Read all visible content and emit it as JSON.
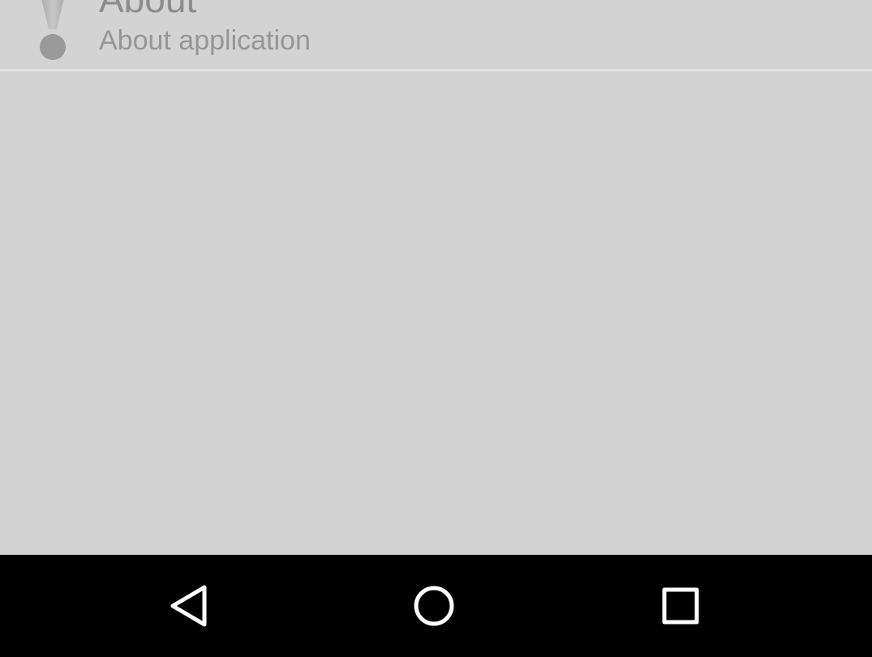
{
  "settings_item": {
    "title": "About",
    "summary": "About application",
    "icon": "info-exclamation-icon"
  },
  "nav_bar": {
    "back_icon": "back-triangle-icon",
    "home_icon": "home-circle-icon",
    "recents_icon": "recents-square-icon"
  },
  "colors": {
    "background": "#d3d3d3",
    "nav_bar": "#000000",
    "nav_icon": "#ffffff",
    "text_primary": "#8c8c8c",
    "text_secondary": "#969696"
  }
}
